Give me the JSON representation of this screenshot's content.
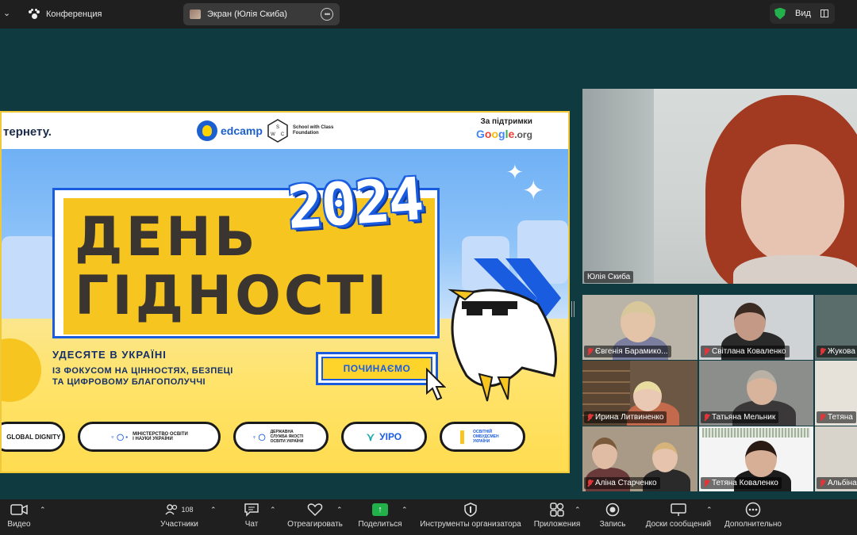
{
  "topbar": {
    "meeting_label": "Конференция",
    "screen_share_label": "Экран (Юлія Скиба)",
    "view_label": "Вид"
  },
  "slide": {
    "header_cut_text": "тернету.",
    "edcamp_logo": "edcamp",
    "swc_logo": "School with Class Foundation",
    "support_label": "За підтримки",
    "google_label": [
      "G",
      "o",
      "o",
      "g",
      "l",
      "e",
      ".org"
    ],
    "title_line1": "ДЕНЬ",
    "title_line2": "ГІДНОСТІ",
    "year": "2024",
    "subtitle_line1": "УДЕСЯТЕ В УКРАЇНІ",
    "subtitle_line2": "ІЗ ФОКУСОМ НА ЦІННОСТЯХ, БЕЗПЕЦІ",
    "subtitle_line3": "ТА ЦИФРОВОМУ БЛАГОПОЛУЧЧІ",
    "start_button": "ПОЧИНАЄМО",
    "partners": [
      "GLOBAL DIGNITY",
      "МІНІСТЕРСТВО ОСВІТИ І НАУКИ УКРАЇНИ",
      "ДЕРЖАВНА СЛУЖБА ЯКОСТІ ОСВІТИ УКРАЇНИ",
      "УІРО",
      "ОСВІТНІЙ ОМБУДСМЕН УКРАЇНИ"
    ]
  },
  "speaker": {
    "name": "Юлія Скиба"
  },
  "gallery": [
    {
      "name": "Євгенія Барамико..."
    },
    {
      "name": "Світлана Коваленко"
    },
    {
      "name": "Жукова"
    },
    {
      "name": "Ирина Литвиненко"
    },
    {
      "name": "Татьяна Мельник"
    },
    {
      "name": "Тетяна"
    },
    {
      "name": "Аліна Старченко"
    },
    {
      "name": "Тетяна Коваленко"
    },
    {
      "name": "Альбіна"
    }
  ],
  "toolbar": {
    "video": "Видео",
    "participants": "Участники",
    "participants_count": "108",
    "chat": "Чат",
    "react": "Отреагировать",
    "share": "Поделиться",
    "host_tools": "Инструменты организатора",
    "apps": "Приложения",
    "record": "Запись",
    "whiteboards": "Доски сообщений",
    "more": "Дополнительно"
  },
  "colors": {
    "stage_bg": "#0f3b40",
    "share_green": "#22b04a",
    "mic_off_red": "#e0363a",
    "slide_yellow": "#ffe36b",
    "slide_blue": "#1a5ce0"
  }
}
